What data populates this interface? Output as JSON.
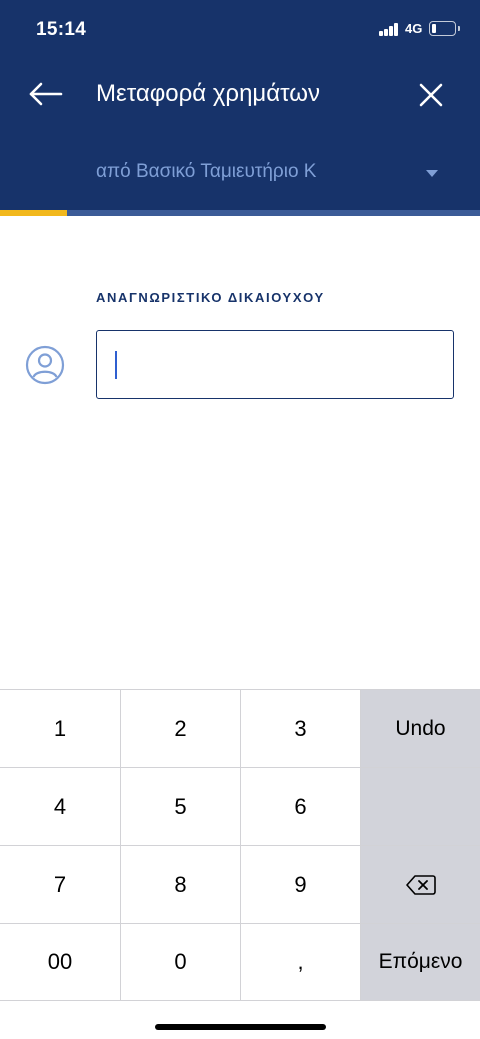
{
  "status_bar": {
    "time": "15:14",
    "network": "4G",
    "signal_bars": 4,
    "battery_level": 0.2,
    "battery_icon": "battery-low-icon"
  },
  "nav": {
    "back_icon": "arrow-left-icon",
    "title": "Μεταφορά χρημάτων",
    "close_icon": "close-icon"
  },
  "account_selector": {
    "label": "από Βασικό Ταμιευτήριο Κ",
    "icon": "caret-down-icon"
  },
  "progress": {
    "fraction": 0.14
  },
  "beneficiary": {
    "label": "ΑΝΑΓΝΩΡΙΣΤΙΚΟ ΔΙΚΑΙΟΥΧΟΥ",
    "value": "",
    "icon": "user-circle-icon"
  },
  "keypad": {
    "rows": [
      [
        "1",
        "2",
        "3",
        "Undo"
      ],
      [
        "4",
        "5",
        "6",
        ""
      ],
      [
        "7",
        "8",
        "9",
        ""
      ],
      [
        "00",
        "0",
        ",",
        "Επόμενο"
      ]
    ],
    "backspace_icon": "backspace-icon"
  },
  "colors": {
    "header": "#17336a",
    "accent": "#f2b81d",
    "link": "#7f9fd6",
    "key_action": "#d2d3da"
  }
}
